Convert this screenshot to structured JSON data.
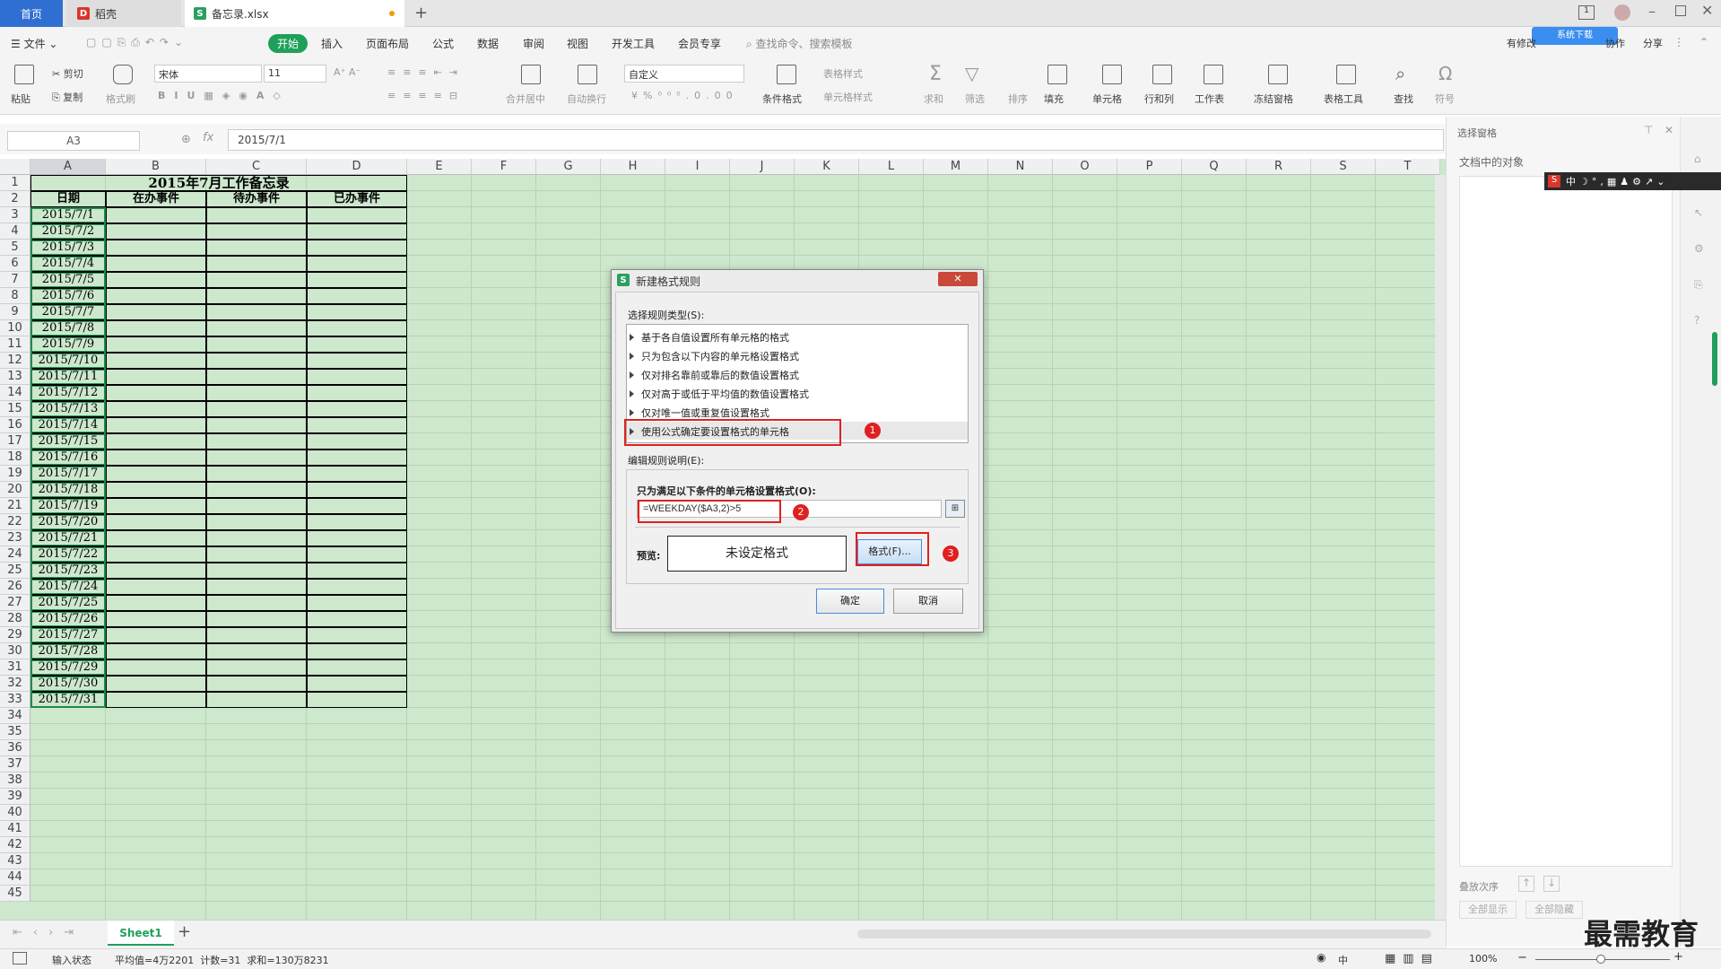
{
  "tabs": {
    "home": "首页",
    "doc": "稻壳",
    "file": "备忘录.xlsx",
    "new": "+"
  },
  "menu": {
    "file": "文件",
    "items": [
      "开始",
      "插入",
      "页面布局",
      "公式",
      "数据",
      "审阅",
      "视图",
      "开发工具",
      "会员专享"
    ],
    "search": "查找命令、搜索模板",
    "sync": "有修改",
    "collab": "协作",
    "share": "分享",
    "cloud_label": "系统下载"
  },
  "ribbon": {
    "paste": "粘贴",
    "cut": "剪切",
    "copy": "复制",
    "format_painter": "格式刷",
    "font_name": "宋体",
    "font_size": "11",
    "merge": "合并居中",
    "wrap": "自动换行",
    "number_format": "自定义",
    "cond_format": "条件格式",
    "table_style": "表格样式",
    "cell_style": "单元格样式",
    "sum": "求和",
    "filter": "筛选",
    "sort": "排序",
    "fill": "填充",
    "cell": "单元格",
    "rowcol": "行和列",
    "sheet": "工作表",
    "freeze": "冻结窗格",
    "tools": "表格工具",
    "find": "查找",
    "symbol": "符号"
  },
  "formula": {
    "namebox": "A3",
    "content": "2015/7/1",
    "fx": "fx"
  },
  "columns": [
    "A",
    "B",
    "C",
    "D",
    "E",
    "F",
    "G",
    "H",
    "I",
    "J",
    "K",
    "L",
    "M",
    "N",
    "O",
    "P",
    "Q",
    "R",
    "S",
    "T"
  ],
  "rows": [
    "1",
    "2",
    "3",
    "4",
    "5",
    "6",
    "7",
    "8",
    "9",
    "10",
    "11",
    "12",
    "13",
    "14",
    "15",
    "16",
    "17",
    "18",
    "19",
    "20",
    "21",
    "22",
    "23",
    "24",
    "25",
    "26",
    "27",
    "28",
    "29",
    "30",
    "31",
    "32",
    "33",
    "34",
    "35",
    "36",
    "37",
    "38",
    "39",
    "40",
    "41",
    "42",
    "43",
    "44",
    "45"
  ],
  "sheet": {
    "title": "2015年7月工作备忘录",
    "headers": [
      "日期",
      "在办事件",
      "待办事件",
      "已办事件"
    ],
    "dates": [
      "2015/7/1",
      "2015/7/2",
      "2015/7/3",
      "2015/7/4",
      "2015/7/5",
      "2015/7/6",
      "2015/7/7",
      "2015/7/8",
      "2015/7/9",
      "2015/7/10",
      "2015/7/11",
      "2015/7/12",
      "2015/7/13",
      "2015/7/14",
      "2015/7/15",
      "2015/7/16",
      "2015/7/17",
      "2015/7/18",
      "2015/7/19",
      "2015/7/20",
      "2015/7/21",
      "2015/7/22",
      "2015/7/23",
      "2015/7/24",
      "2015/7/25",
      "2015/7/26",
      "2015/7/27",
      "2015/7/28",
      "2015/7/29",
      "2015/7/30",
      "2015/7/31"
    ]
  },
  "sheettabs": {
    "active": "Sheet1",
    "add": "+"
  },
  "status": {
    "mode": "输入状态",
    "stats": "平均值=4万2201  计数=31  求和=130万8231",
    "zoom": "100%",
    "ime": "中"
  },
  "panel": {
    "title": "选择窗格",
    "objects": "文档中的对象",
    "order": "叠放次序",
    "show_all": "全部显示",
    "hide_all": "全部隐藏"
  },
  "dialog": {
    "title": "新建格式规则",
    "select_type": "选择规则类型(S):",
    "rules": [
      "基于各自值设置所有单元格的格式",
      "只为包含以下内容的单元格设置格式",
      "仅对排名靠前或靠后的数值设置格式",
      "仅对高于或低于平均值的数值设置格式",
      "仅对唯一值或重复值设置格式",
      "使用公式确定要设置格式的单元格"
    ],
    "edit_desc": "编辑规则说明(E):",
    "formula_label": "只为满足以下条件的单元格设置格式(O):",
    "formula": "=WEEKDAY($A3,2)>5",
    "preview_label": "预览:",
    "preview_text": "未设定格式",
    "format_btn": "格式(F)...",
    "ok": "确定",
    "cancel": "取消",
    "badges": [
      "1",
      "2",
      "3"
    ]
  },
  "watermark": "最需教育",
  "colors": {
    "grid_bg": "#cde8cd",
    "accent": "#1fa05a",
    "home_tab": "#2f6fd2",
    "marker": "#e02020"
  }
}
